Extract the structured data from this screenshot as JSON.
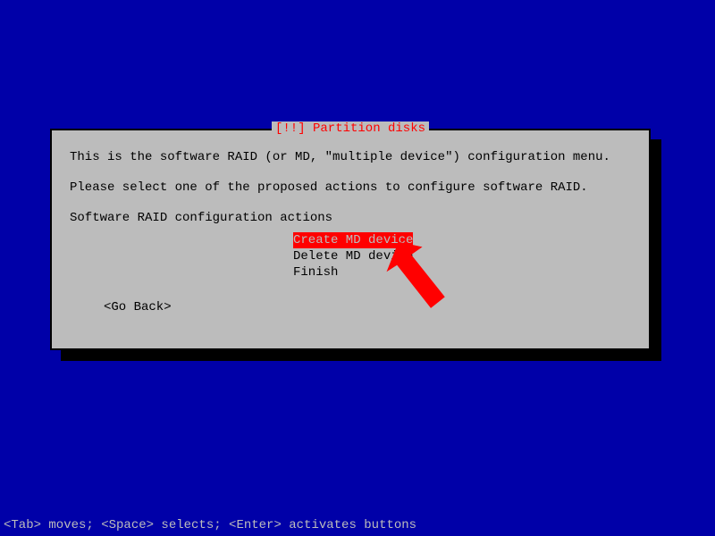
{
  "dialog": {
    "title_marker_left": "[!!]",
    "title_text": " Partition disks ",
    "intro1": "This is the software RAID (or MD, \"multiple device\") configuration menu.",
    "intro2": "Please select one of the proposed actions to configure software RAID.",
    "prompt": "Software RAID configuration actions",
    "menu": {
      "item0": "Create MD device",
      "item1": "Delete MD device",
      "item2": "Finish"
    },
    "go_back": "<Go Back>"
  },
  "footer": {
    "hint": "<Tab> moves; <Space> selects; <Enter> activates buttons"
  }
}
